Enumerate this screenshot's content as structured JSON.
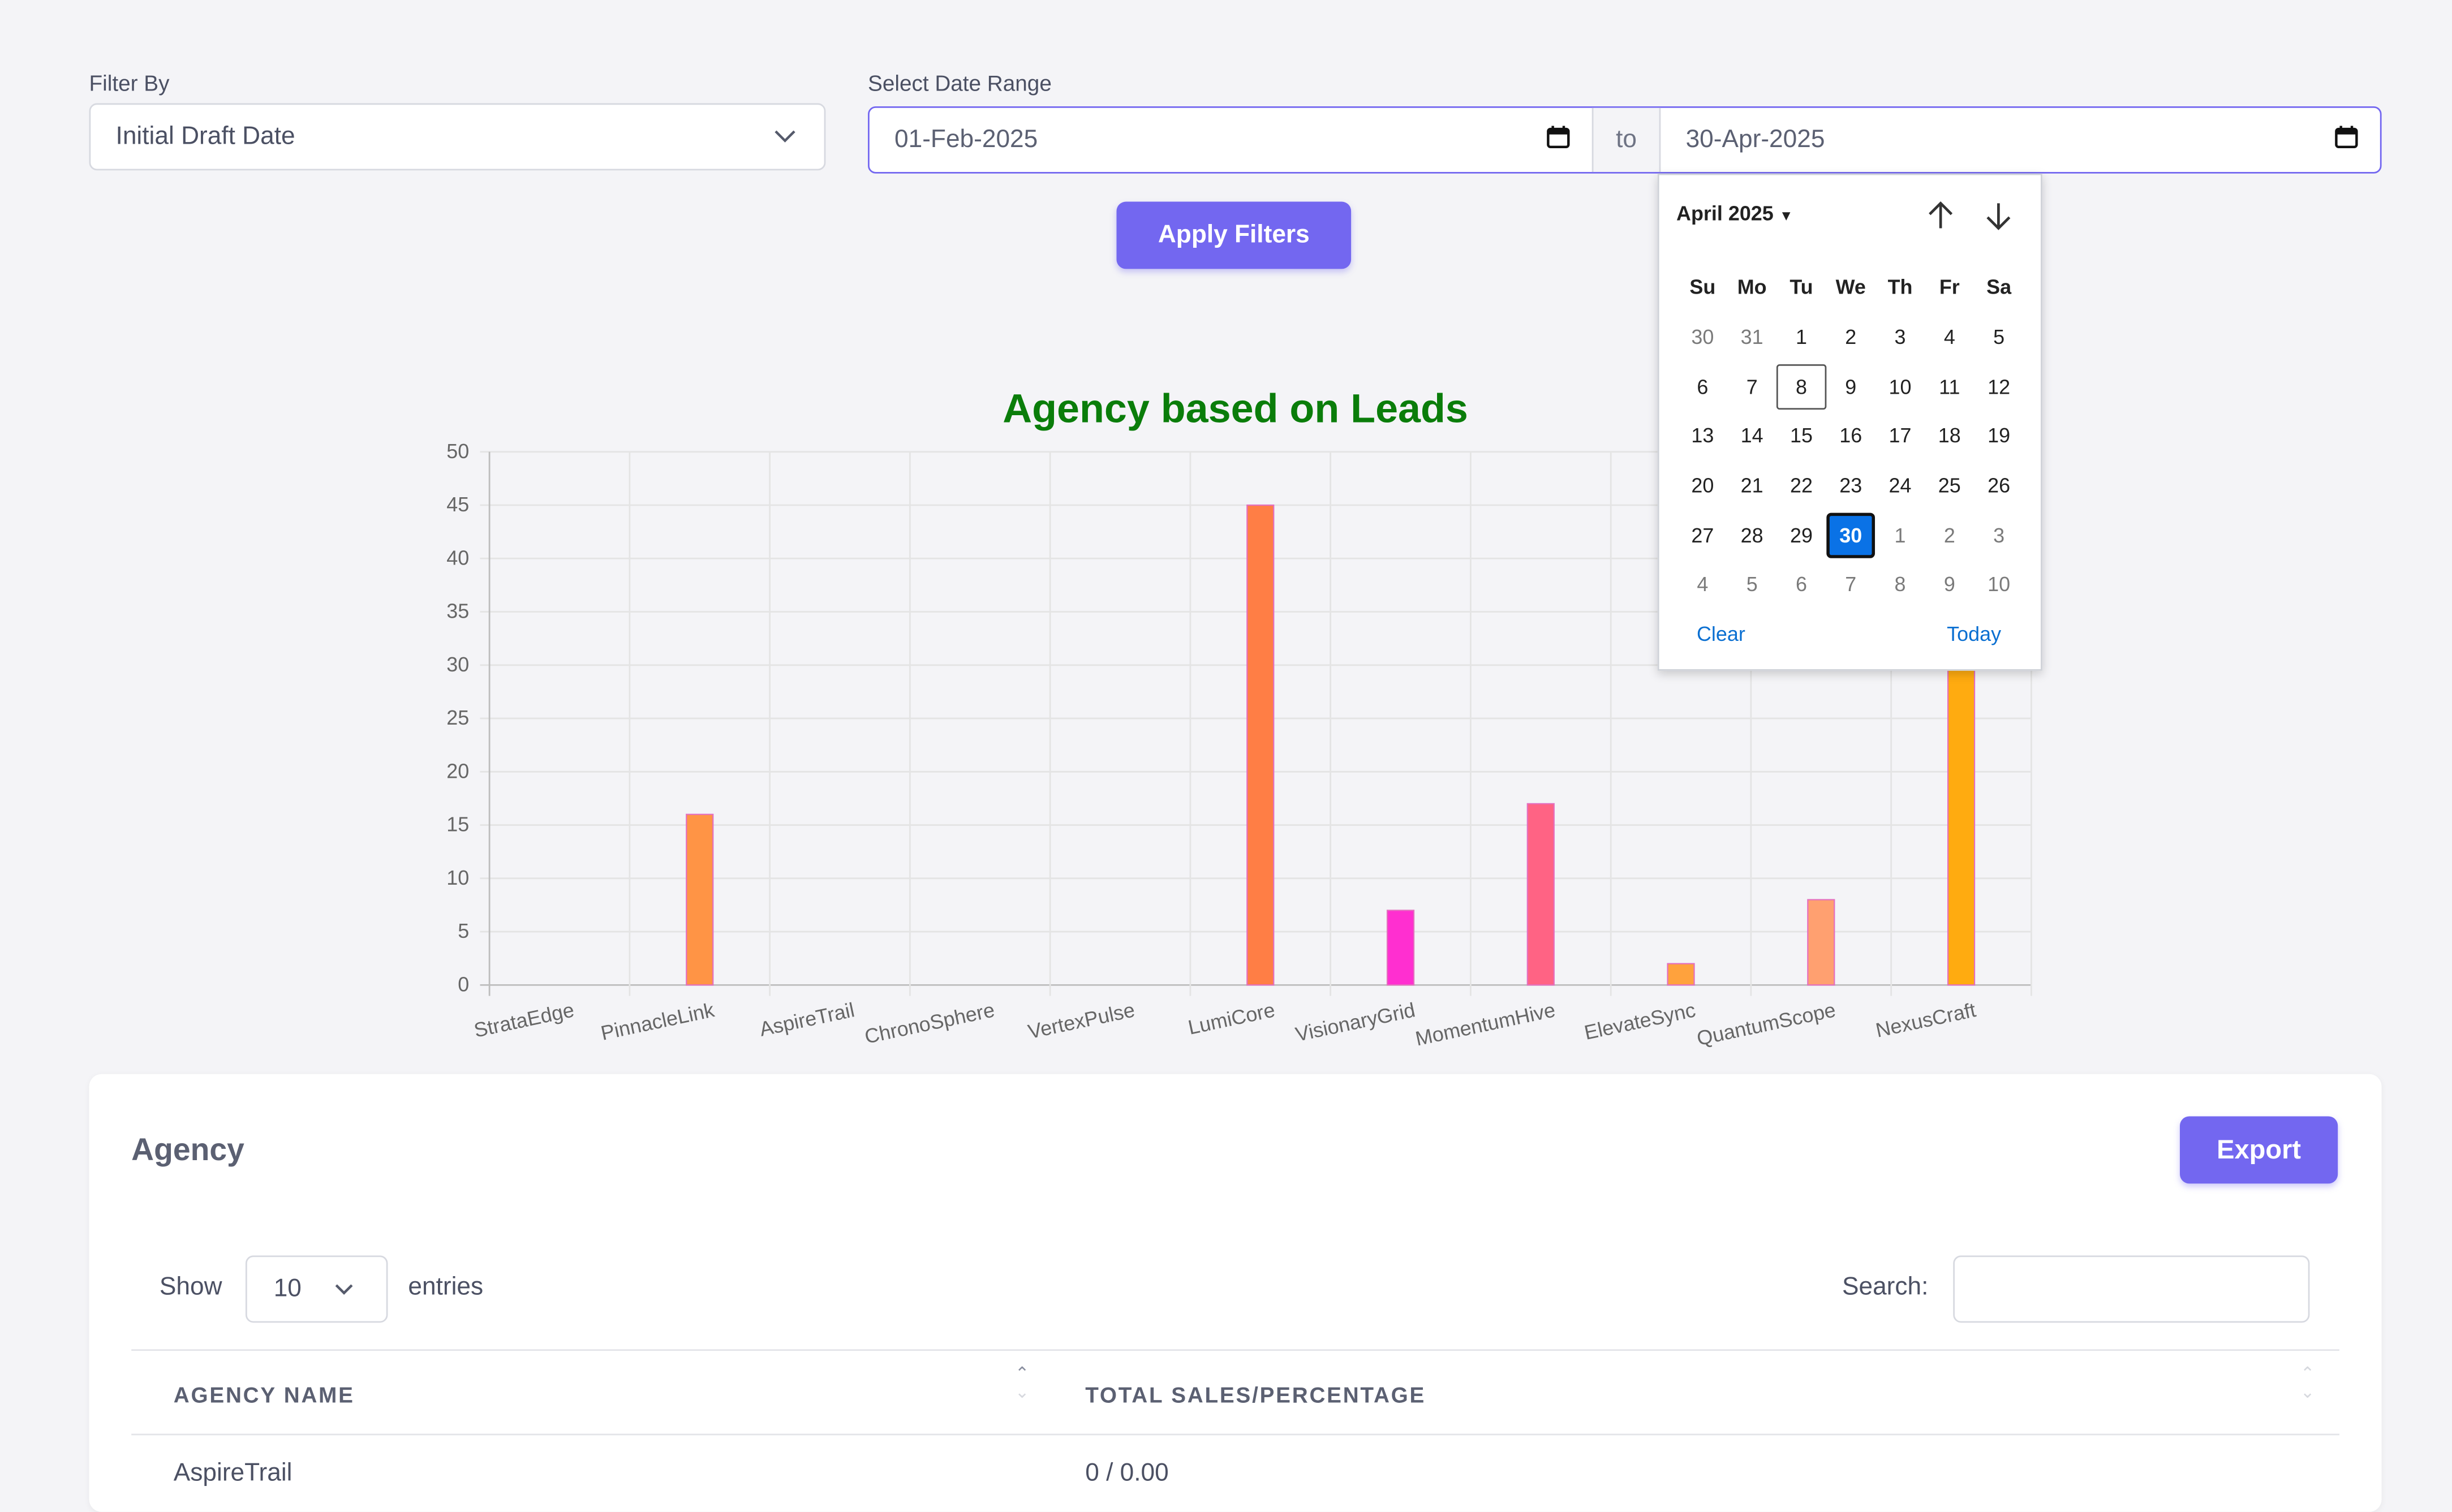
{
  "filter": {
    "label": "Filter By",
    "selected": "Initial Draft Date"
  },
  "date_range": {
    "label": "Select Date Range",
    "from": "01-Feb-2025",
    "separator": "to",
    "to": "30-Apr-2025"
  },
  "apply_button": "Apply Filters",
  "datepicker": {
    "month_label": "April 2025",
    "weekdays": [
      "Su",
      "Mo",
      "Tu",
      "We",
      "Th",
      "Fr",
      "Sa"
    ],
    "weeks": [
      [
        "30",
        "31",
        "1",
        "2",
        "3",
        "4",
        "5"
      ],
      [
        "6",
        "7",
        "8",
        "9",
        "10",
        "11",
        "12"
      ],
      [
        "13",
        "14",
        "15",
        "16",
        "17",
        "18",
        "19"
      ],
      [
        "20",
        "21",
        "22",
        "23",
        "24",
        "25",
        "26"
      ],
      [
        "27",
        "28",
        "29",
        "30",
        "1",
        "2",
        "3"
      ],
      [
        "4",
        "5",
        "6",
        "7",
        "8",
        "9",
        "10"
      ]
    ],
    "today": "8",
    "selected": "30",
    "clear_label": "Clear",
    "today_label": "Today",
    "selected_color": "#0a72e6"
  },
  "chart_data": {
    "type": "bar",
    "title": "Agency based on Leads",
    "title_color": "#0a7d0a",
    "categories": [
      "StrataEdge",
      "PinnacleLink",
      "AspireTrail",
      "ChronoSphere",
      "VertexPulse",
      "LumiCore",
      "VisionaryGrid",
      "MomentumHive",
      "ElevateSync",
      "QuantumScope",
      "NexusCraft"
    ],
    "values": [
      0,
      16,
      0,
      0,
      0,
      45,
      7,
      17,
      2,
      8,
      30
    ],
    "colors": [
      "#ff8a3d",
      "#ff9445",
      "#ff8a3d",
      "#ff8a3d",
      "#ff8a3d",
      "#ff7e45",
      "#ff2fd0",
      "#ff6384",
      "#ffa23d",
      "#ffa070",
      "#ffab10"
    ],
    "ylim": [
      0,
      50
    ],
    "yticks": [
      "0",
      "5",
      "10",
      "15",
      "20",
      "25",
      "30",
      "35",
      "40",
      "45",
      "50"
    ],
    "grid": true,
    "legend": false
  },
  "table_card": {
    "title": "Agency",
    "export_label": "Export",
    "show_label": "Show",
    "entries_value": "10",
    "entries_label": "entries",
    "search_label": "Search:",
    "search_value": "",
    "columns": [
      "AGENCY NAME",
      "TOTAL SALES/PERCENTAGE"
    ],
    "rows": [
      [
        "AspireTrail",
        "0 / 0.00"
      ]
    ]
  }
}
